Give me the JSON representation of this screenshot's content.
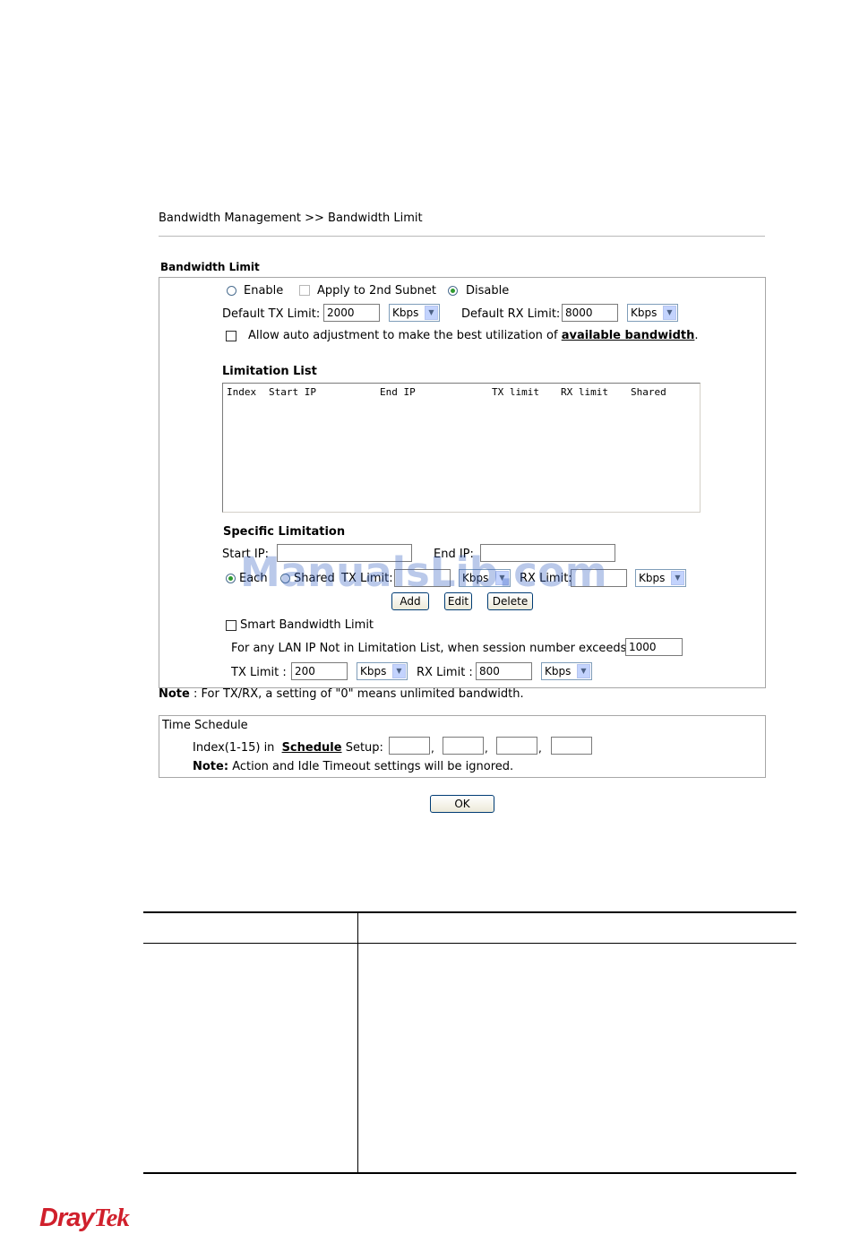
{
  "header": {
    "breadcrumb": "Bandwidth Management >> Bandwidth Limit"
  },
  "bandwidth_limit": {
    "title": "Bandwidth Limit",
    "enable_label": "Enable",
    "apply_2nd_subnet_label": "Apply to 2nd Subnet",
    "disable_label": "Disable",
    "selected_mode": "Disable",
    "default_tx_label": "Default TX Limit:",
    "default_tx_value": "2000",
    "default_tx_unit": "Kbps",
    "default_rx_label": "Default RX Limit:",
    "default_rx_value": "8000",
    "default_rx_unit": "Kbps",
    "auto_adjust_text": "Allow auto adjustment to make the best utilization of",
    "auto_adjust_link": "available bandwidth",
    "auto_adjust_period": "."
  },
  "limitation_list": {
    "title": "Limitation List",
    "columns": [
      "Index",
      "Start IP",
      "End IP",
      "TX limit",
      "RX limit",
      "Shared"
    ]
  },
  "specific_limitation": {
    "title": "Specific Limitation",
    "start_ip_label": "Start IP:",
    "end_ip_label": "End IP:",
    "each_label": "Each",
    "shared_label": "Shared",
    "tx_limit_label": "TX Limit:",
    "tx_unit": "Kbps",
    "rx_limit_label": "RX Limit:",
    "rx_unit": "Kbps",
    "add_button": "Add",
    "edit_button": "Edit",
    "delete_button": "Delete"
  },
  "smart_bandwidth": {
    "title": "Smart Bandwidth Limit",
    "description": "For any LAN IP Not in Limitation List, when session number exceeds",
    "session_value": "1000",
    "tx_label": "TX Limit :",
    "tx_value": "200",
    "tx_unit": "Kbps",
    "rx_label": "RX Limit :",
    "rx_value": "800",
    "rx_unit": "Kbps"
  },
  "note": {
    "label": "Note",
    "text": ": For TX/RX, a setting of \"0\" means unlimited bandwidth."
  },
  "time_schedule": {
    "title": "Time Schedule",
    "index_text": "Index(1-15) in",
    "schedule_link": "Schedule",
    "setup_text": "Setup:",
    "note_label": "Note:",
    "note_text": "Action and Idle Timeout settings will be ignored."
  },
  "ok_button": "OK",
  "watermark": "ManualsLib.com",
  "logo": {
    "part1": "Dray",
    "part2": "Tek"
  },
  "colors": {
    "accent_green": "#2f9a2f",
    "logo_red": "#d0202c",
    "watermark_blue": "#3b66c4"
  }
}
